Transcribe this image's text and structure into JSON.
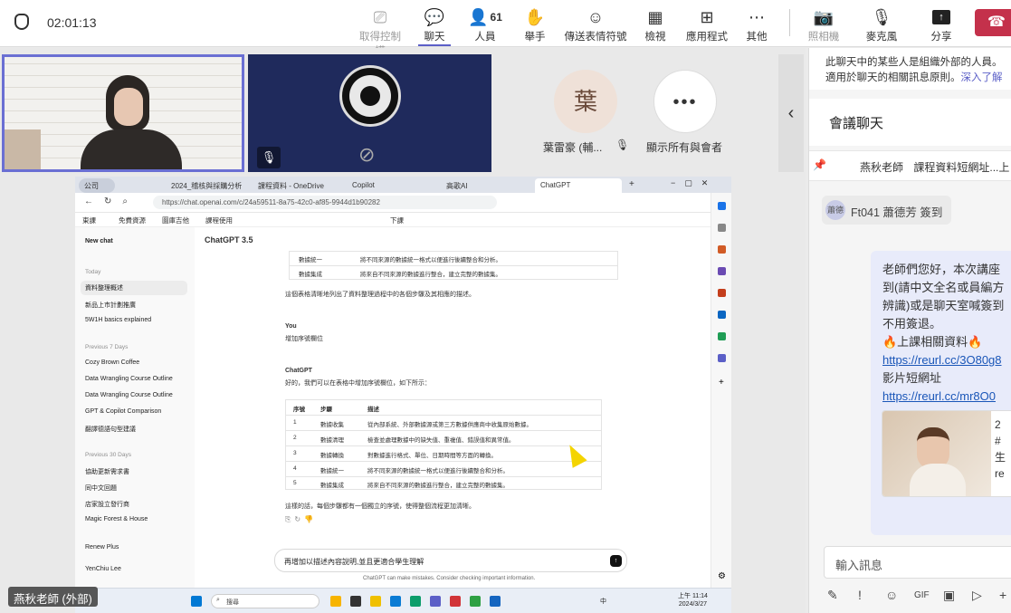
{
  "meeting": {
    "timer": "02:01:13",
    "toolbar": [
      {
        "label": "取得控制權",
        "icon": "control-icon",
        "disabled": true
      },
      {
        "label": "聊天",
        "icon": "chat-icon",
        "active": true
      },
      {
        "label": "人員",
        "icon": "people-icon",
        "count": "61"
      },
      {
        "label": "舉手",
        "icon": "raise-hand-icon"
      },
      {
        "label": "傳送表情符號",
        "icon": "emoji-icon"
      },
      {
        "label": "檢視",
        "icon": "view-icon"
      },
      {
        "label": "應用程式",
        "icon": "apps-icon"
      },
      {
        "label": "其他",
        "icon": "more-icon"
      },
      {
        "label": "照相機",
        "icon": "camera-off-icon",
        "disabled": true
      },
      {
        "label": "麥克風",
        "icon": "mic-off-icon"
      },
      {
        "label": "分享",
        "icon": "share-icon"
      }
    ],
    "participants": [
      {
        "avatar_text": "葉",
        "name": "葉雷豪 (輔..."
      },
      {
        "avatar_text": "•••",
        "name": "顯示所有與會者"
      }
    ],
    "presenter_tag": "燕秋老師 (外部)"
  },
  "browser": {
    "tabs": [
      "公司",
      "2024_稽核與採購分析...",
      "課程資料 - OneDrive",
      "Copilot",
      "高歌AI",
      "ChatGPT"
    ],
    "url": "https://chat.openai.com/c/24a59511-8a75-42c0-af85-9944d1b90282",
    "bookmarks": [
      "東課",
      "免費資源",
      "圖庫吉他",
      "課程使用",
      "下課"
    ]
  },
  "chatgpt": {
    "new_chat": "New chat",
    "model": "ChatGPT 3.5",
    "sidebar": {
      "today_label": "Today",
      "today": [
        "資料整理概述",
        "新品上市計劃推廣",
        "5W1H basics explained"
      ],
      "prev7_label": "Previous 7 Days",
      "prev7": [
        "Cozy Brown Coffee",
        "Data Wrangling Course Outline",
        "Data Wrangling Course Outline",
        "GPT & Copilot Comparison",
        "翻譯德語句型建議"
      ],
      "prev30_label": "Previous 30 Days",
      "prev30": [
        "協助更新需求書",
        "同中文回題",
        "店家設立發行商",
        "Magic Forest & House"
      ],
      "renew": "Renew Plus",
      "user": "YenChiu Lee"
    },
    "top_rows": [
      [
        "數據統一",
        "將不同來源的數據統一格式以便進行後續整合和分析。"
      ],
      [
        "數據集成",
        "將來自不同來源的數據進行整合，建立完整的數據集。"
      ]
    ],
    "summary_line": "這個表格清晰地列出了資料整理過程中的各個步驟及其相應的描述。",
    "user_label": "You",
    "user_msg": "增加序號欄位",
    "bot_label": "ChatGPT",
    "bot_intro": "好的，我們可以在表格中增加序號欄位，如下所示：",
    "table_header": [
      "序號",
      "步驟",
      "描述"
    ],
    "table_rows": [
      [
        "1",
        "數據收集",
        "從內部系統、外部數據源或第三方數據供應商中收集原始數據。"
      ],
      [
        "2",
        "數據清理",
        "檢查並處理數據中的缺失值、重複值、錯誤值和異常值。"
      ],
      [
        "3",
        "數據轉換",
        "對數據進行格式、單位、日期時間等方面的轉換。"
      ],
      [
        "4",
        "數據統一",
        "將不同來源的數據統一格式以便進行後續整合和分析。"
      ],
      [
        "5",
        "數據集成",
        "將來自不同來源的數據進行整合，建立完整的數據集。"
      ]
    ],
    "outro": "這樣的話，每個步驟都有一個獨立的序號，使得整個流程更加清晰。",
    "input_text": "再增加以描述內容說明,並且更適合學生理解",
    "disclaimer": "ChatGPT can make mistakes. Consider checking important information."
  },
  "taskbar": {
    "search": "搜尋",
    "ime": "中",
    "time": "上午 11:14",
    "date": "2024/3/27"
  },
  "chat": {
    "notice_line1": "此聊天中的某些人是組織外部的人員。",
    "notice_line2": "適用於聊天的相關訊息原則。",
    "notice_link": "深入了解",
    "title": "會議聊天",
    "pinned_name": "燕秋老師",
    "pinned_text": "課程資料短網址...上",
    "sys_avatar": "蕭德",
    "sys_msg": "Ft041 蕭德芳 簽到",
    "bubble_lines": [
      "老師們您好，本次講座",
      "到(請中文全名或員編方",
      "辨識)或是聊天室喊簽到",
      "不用簽退。"
    ],
    "resource_line": "🔥上課相關資料🔥",
    "link1": "https://reurl.cc/3O80g8",
    "video_label": "影片短網址",
    "link2": "https://reurl.cc/mr8O0",
    "card_texts": [
      "2",
      "#",
      "生",
      "re"
    ],
    "compose_placeholder": "輸入訊息"
  },
  "colors": {
    "accent": "#5b5fc7",
    "leave": "#c4314b"
  }
}
